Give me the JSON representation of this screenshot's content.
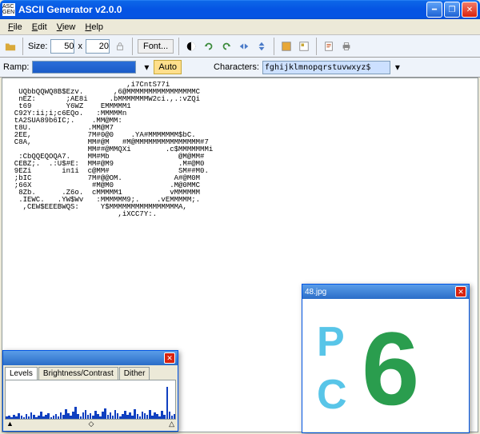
{
  "window": {
    "title": "ASCII Generator v2.0.0",
    "app_icon_text": "ASC GEN"
  },
  "menu": {
    "file": "File",
    "edit": "Edit",
    "view": "View",
    "help": "Help"
  },
  "toolbar": {
    "size_label": "Size:",
    "width": "50",
    "x": "x",
    "height": "20",
    "font_btn": "Font..."
  },
  "params": {
    "ramp_label": "Ramp:",
    "auto_btn": "Auto",
    "chars_label": "Characters:",
    "chars_value": "fghijklmnopqrstuvwxyz$"
  },
  "ascii_art": "                            ,i7CntS77i\n   UQbbQQWQ8B$Ezv.       ,6@MMMMMMMMMMMMMMMMC\n   nEZ:       ;AE8i     .bMMMMMMMW2ci.,.:vZQi\n   t69        Y6WZ    EMMMMM1\n  C92Y:ii;i;c6EQo.   :MMMMMn\n  tA2SUA89b6IC;.    .MM@MM:\n  t8U.             .MM@M7\n  2EE,             7M#0@0    .YA#MMMMMMM$bC.\n  C8A,             MM#@M   #M@MMMMMMMMMMMMMMM#7\n                   MM##@MMQXi        .c$MMMMMMMi\n   :CbQQEQOQA7.    MM#Mb                @M@MM#\n  CEBZ;.  .:U$#E:  MM#@M9               .M#@M0\n  9EZi       in1i  c@MM#                SM##M0.\n  ;bIC             7M#@@OM.            A#@M0M\n  ;66X              #M@M0             .M@0MMC\n   8Zb.      .Z6o.  cMMMMM1           vMMMMMM\n   .IEWC.   .YW$Wv   :MMMMMM9;.    .vEMMMMM;.\n    ,CEW$EEEBWQS:     Y$MMMMMMMMMMMMMMMMA,\n                          ,iXCC7Y:.",
  "levels_window": {
    "title": "",
    "tabs": {
      "levels": "Levels",
      "bc": "Brightness/Contrast",
      "dither": "Dither"
    },
    "slider_vals": [
      "▲",
      "◇",
      "△"
    ],
    "histogram": [
      3,
      4,
      2,
      5,
      3,
      7,
      4,
      2,
      6,
      3,
      8,
      5,
      2,
      4,
      9,
      3,
      5,
      7,
      2,
      4,
      6,
      3,
      8,
      5,
      12,
      7,
      4,
      9,
      15,
      6,
      3,
      8,
      11,
      5,
      7,
      4,
      10,
      6,
      3,
      9,
      13,
      5,
      8,
      4,
      11,
      7,
      3,
      6,
      10,
      5,
      8,
      4,
      12,
      6,
      3,
      9,
      7,
      5,
      11,
      4,
      8,
      6,
      3,
      10,
      5,
      40,
      9,
      4,
      6,
      3
    ]
  },
  "image_window": {
    "title": "48.jpg",
    "logo_p": "P",
    "logo_c": "C",
    "logo_6": "6"
  }
}
